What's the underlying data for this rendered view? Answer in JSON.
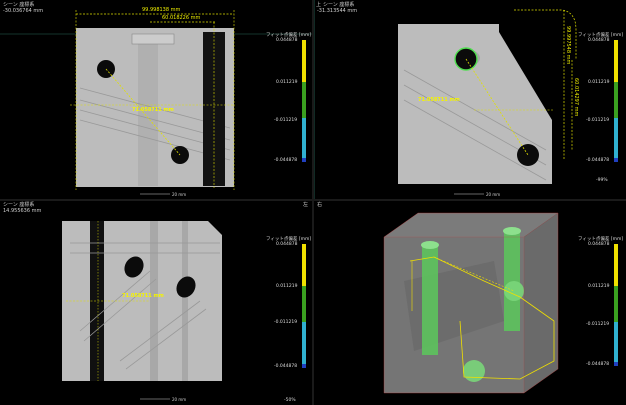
{
  "panes": {
    "top_left": {
      "title": "シーン 座標系",
      "coord": "-30.036764 mm",
      "meas_top": "99.998138 mm",
      "meas_mid": "60.018226 mm",
      "meas_diag": "71.058711 mm",
      "scale": "20 mm"
    },
    "top_right": {
      "title": "シーン 座標系",
      "title_prefix": "上",
      "coord": "-31.313544 mm",
      "meas_diag": "71.058711 mm",
      "meas_side_a": "99.997548 mm",
      "meas_side_b": "60.014297 mm",
      "scale": "20 mm"
    },
    "bottom_left": {
      "title": "シーン 座標系",
      "title_prefix": "左",
      "coord": "14.955636 mm",
      "meas_center": "71.058711 mm",
      "scale": "20 mm"
    },
    "bottom_right": {
      "title_prefix": "右"
    }
  },
  "colorbars": {
    "label": "フィット点偏差 [mm]",
    "ticks": [
      "0.044878",
      "0.011219",
      "-0.011219",
      "-0.044878"
    ],
    "percent_top_right": "-99%",
    "percent_bottom_left": "-50%",
    "colors": {
      "yellow": "#f0e000",
      "green": "#3aa020",
      "cyan": "#30b0d0",
      "blue": "#2040c0"
    }
  }
}
